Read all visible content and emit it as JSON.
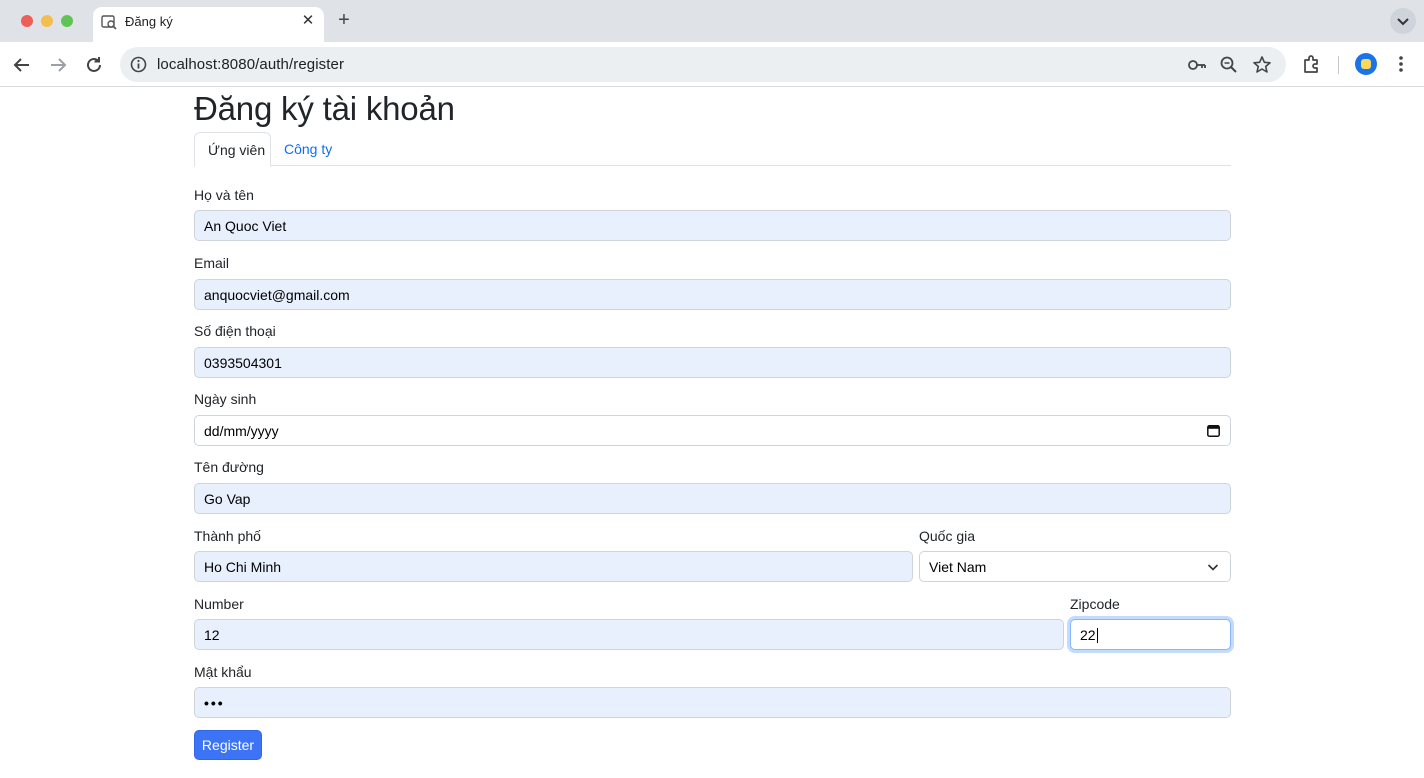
{
  "browser": {
    "tab_title": "Đăng ký",
    "url": "localhost:8080/auth/register"
  },
  "page": {
    "heading": "Đăng ký tài khoản",
    "tabs": [
      {
        "label": "Ứng viên",
        "active": true
      },
      {
        "label": "Công ty",
        "active": false
      }
    ],
    "form": {
      "fullname": {
        "label": "Họ và tên",
        "value": "An Quoc Viet"
      },
      "email": {
        "label": "Email",
        "value": "anquocviet@gmail.com"
      },
      "phone": {
        "label": "Số điện thoại",
        "value": "0393504301"
      },
      "dob": {
        "label": "Ngày sinh",
        "value": "dd/mm/yyyy"
      },
      "street": {
        "label": "Tên đường",
        "value": "Go Vap"
      },
      "city": {
        "label": "Thành phố",
        "value": "Ho Chi Minh"
      },
      "country": {
        "label": "Quốc gia",
        "value": "Viet Nam"
      },
      "number": {
        "label": "Number",
        "value": "12"
      },
      "zipcode": {
        "label": "Zipcode",
        "value": "22"
      },
      "password": {
        "label": "Mật khẩu",
        "value": "•••"
      }
    },
    "submit_label": "Register"
  },
  "colors": {
    "primary": "#0d6efd",
    "autofill_bg": "#e8f0fe"
  },
  "icons": [
    "back-icon",
    "forward-icon",
    "reload-icon",
    "info-icon",
    "password-key-icon",
    "zoom-icon",
    "bookmark-star-icon",
    "extensions-icon",
    "menu-icon",
    "calendar-icon",
    "chevron-down-icon"
  ]
}
